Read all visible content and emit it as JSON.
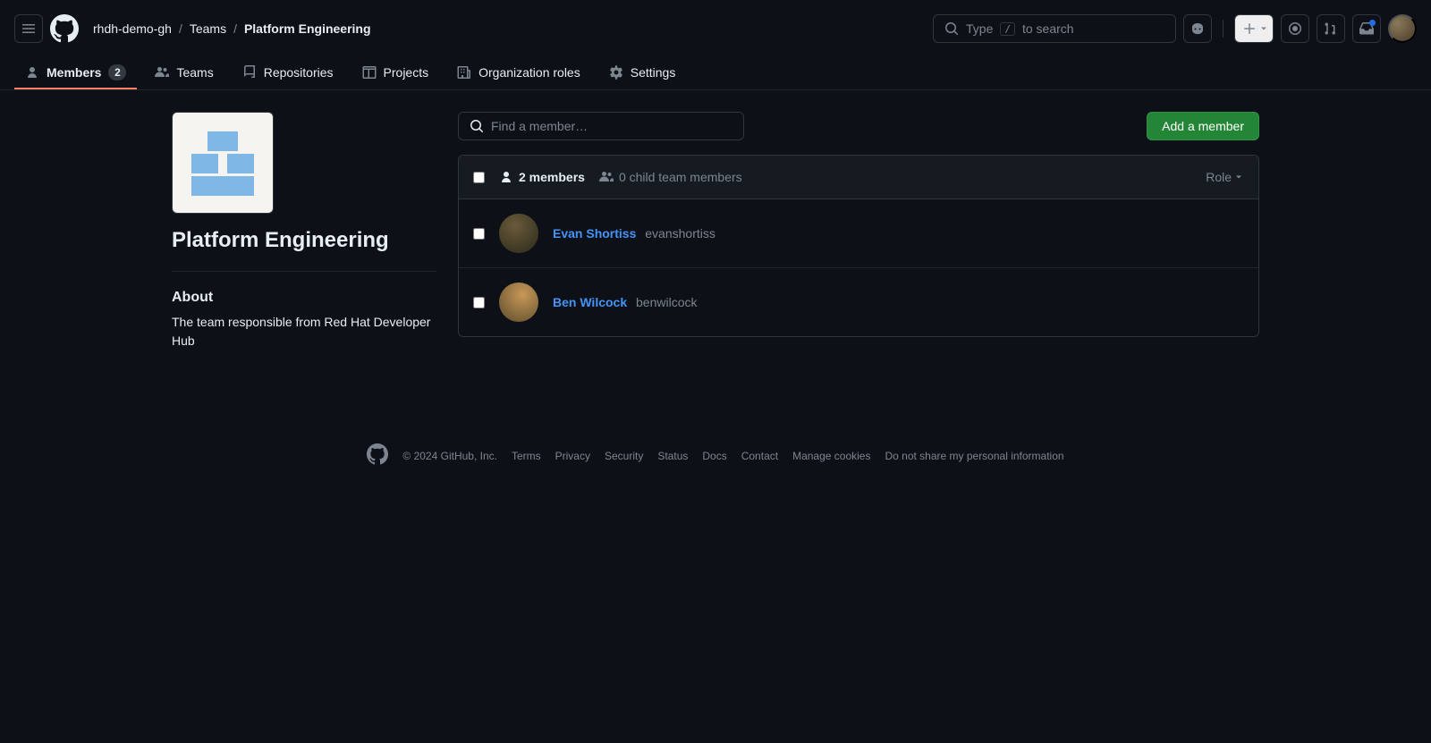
{
  "header": {
    "search_label": "Type",
    "search_kbd": "/",
    "search_suffix": "to search",
    "breadcrumb": {
      "org": "rhdh-demo-gh",
      "teams": "Teams",
      "current": "Platform Engineering"
    }
  },
  "nav": {
    "members": "Members",
    "members_count": "2",
    "teams": "Teams",
    "repos": "Repositories",
    "projects": "Projects",
    "org_roles": "Organization roles",
    "settings": "Settings"
  },
  "side": {
    "team_name": "Platform Engineering",
    "about_heading": "About",
    "about_text": "The team responsible from Red Hat Developer Hub"
  },
  "main": {
    "find_placeholder": "Find a member…",
    "add_member": "Add a member",
    "tab_members": "2 members",
    "tab_child": "0 child team members",
    "role_label": "Role",
    "members": [
      {
        "name": "Evan Shortiss",
        "username": "evanshortiss"
      },
      {
        "name": "Ben Wilcock",
        "username": "benwilcock"
      }
    ]
  },
  "footer": {
    "copyright": "© 2024 GitHub, Inc.",
    "links": [
      "Terms",
      "Privacy",
      "Security",
      "Status",
      "Docs",
      "Contact",
      "Manage cookies",
      "Do not share my personal information"
    ]
  }
}
